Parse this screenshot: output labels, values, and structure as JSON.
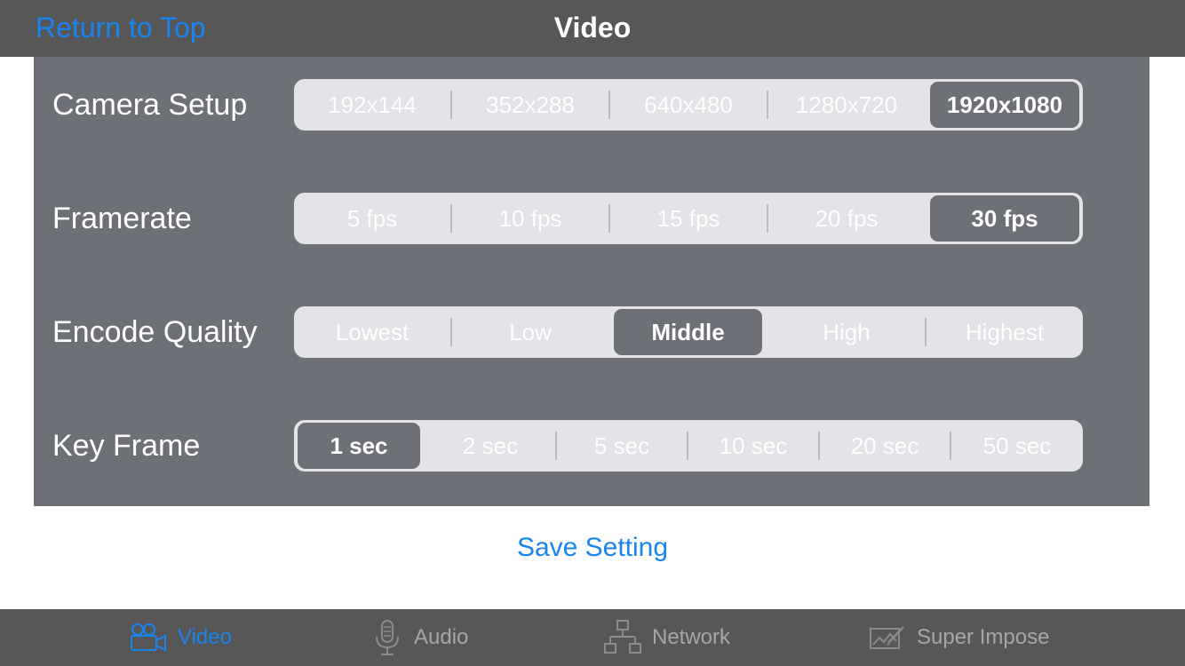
{
  "nav": {
    "back_label": "Return to Top",
    "title": "Video"
  },
  "settings": {
    "camera_setup": {
      "label": "Camera Setup",
      "options": [
        "192x144",
        "352x288",
        "640x480",
        "1280x720",
        "1920x1080"
      ],
      "selected": "1920x1080"
    },
    "framerate": {
      "label": "Framerate",
      "options": [
        "5 fps",
        "10 fps",
        "15 fps",
        "20 fps",
        "30 fps"
      ],
      "selected": "30 fps"
    },
    "encode_quality": {
      "label": "Encode Quality",
      "options": [
        "Lowest",
        "Low",
        "Middle",
        "High",
        "Highest"
      ],
      "selected": "Middle"
    },
    "key_frame": {
      "label": "Key Frame",
      "options": [
        "1 sec",
        "2 sec",
        "5 sec",
        "10 sec",
        "20 sec",
        "50 sec"
      ],
      "selected": "1 sec"
    }
  },
  "save_label": "Save Setting",
  "tabs": [
    {
      "label": "Video",
      "icon": "video-camera-icon",
      "active": true
    },
    {
      "label": "Audio",
      "icon": "microphone-icon",
      "active": false
    },
    {
      "label": "Network",
      "icon": "network-icon",
      "active": false
    },
    {
      "label": "Super Impose",
      "icon": "super-impose-icon",
      "active": false
    }
  ],
  "colors": {
    "accent": "#1a84f0",
    "bar_background": "#575757",
    "panel_background": "#6e7078",
    "segment_background": "#e3e3e8"
  }
}
